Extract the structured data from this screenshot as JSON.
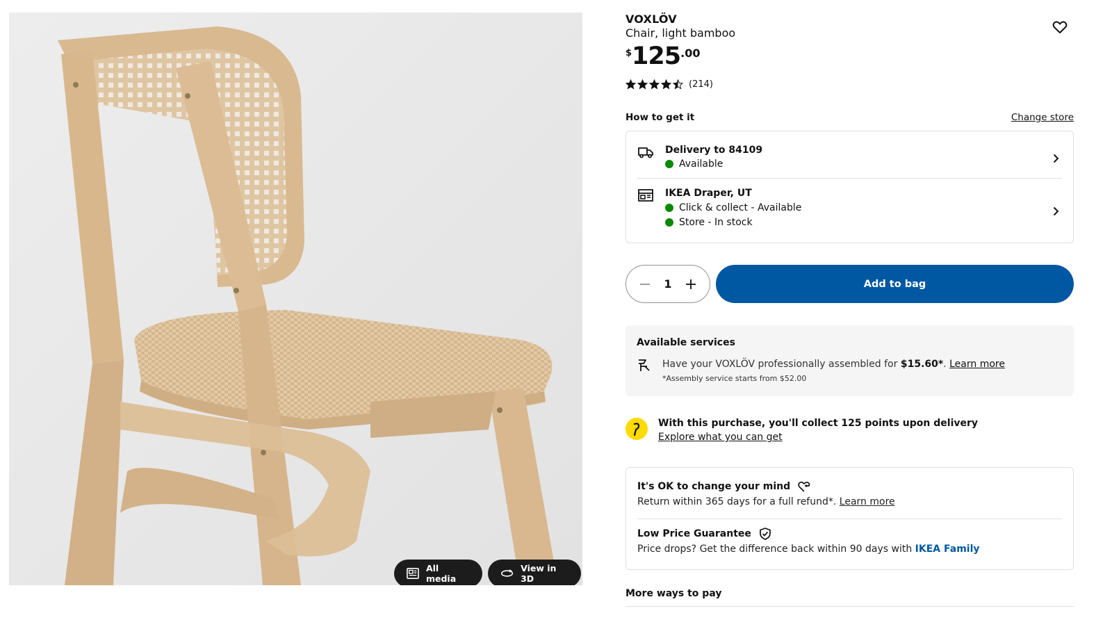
{
  "product": {
    "brand": "VOXLÖV",
    "description": "Chair, light bamboo",
    "price": {
      "currency": "$",
      "integer": "125",
      "decimal": ".00"
    },
    "rating": {
      "stars": 4.5,
      "max": 5,
      "count": "(214)"
    },
    "favorite_icon": "heart-icon"
  },
  "media": {
    "all_media_label": "All media",
    "view3d_label": "View in 3D"
  },
  "availability": {
    "heading": "How to get it",
    "change_store": "Change store",
    "delivery": {
      "title": "Delivery to 84109",
      "status": "Available",
      "icon": "truck-icon"
    },
    "store": {
      "title": "IKEA Draper, UT",
      "status_1": "Click & collect - Available",
      "status_2": "Store - In stock",
      "icon": "store-icon"
    },
    "status_color": "#0a8a00"
  },
  "purchase": {
    "quantity": "1",
    "add_to_bag": "Add to bag",
    "accent": "#0058a3"
  },
  "services": {
    "heading": "Available services",
    "text_before": "Have your VOXLÖV professionally assembled for ",
    "price": "$15.60*",
    "text_after": ". ",
    "link": "Learn more",
    "note": "*Assembly service starts from $52.00"
  },
  "points": {
    "text": "With this purchase, you'll collect 125 points upon delivery",
    "link": "Explore what you can get",
    "badge_color": "#ffdb00"
  },
  "policies": {
    "change_mind": {
      "title": "It's OK to change your mind",
      "body": "Return within 365 days for a full refund*. ",
      "link": "Learn more"
    },
    "price_guarantee": {
      "title": "Low Price Guarantee",
      "body": "Price drops? Get the difference back within 90 days with ",
      "family": "IKEA Family"
    }
  },
  "more_ways": "More ways to pay"
}
